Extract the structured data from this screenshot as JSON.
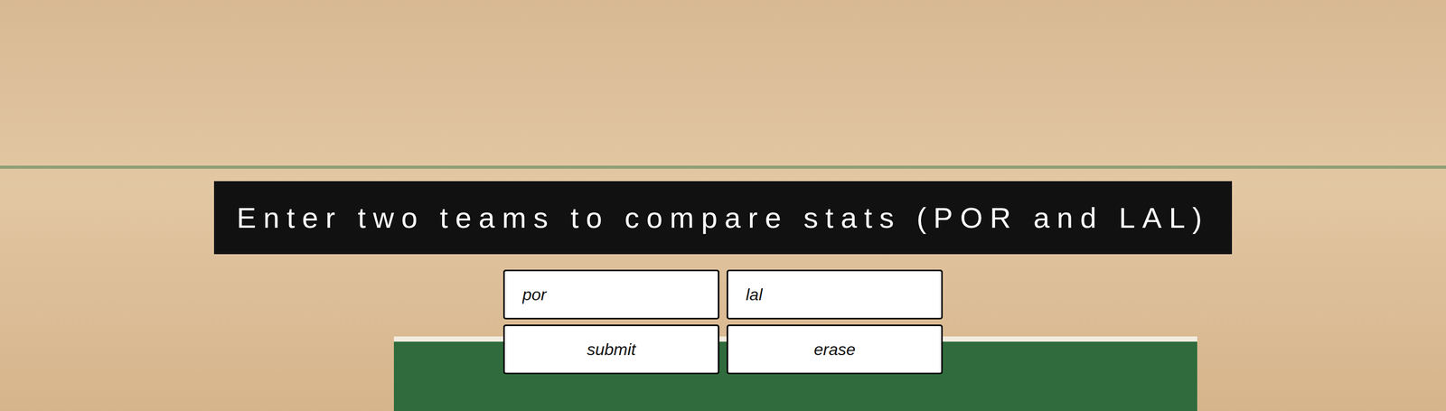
{
  "banner": {
    "title": "Enter two teams to compare stats (POR and LAL)"
  },
  "fields": [
    {
      "value": "por"
    },
    {
      "value": "lal"
    }
  ],
  "buttons": [
    "submit",
    "erase"
  ]
}
